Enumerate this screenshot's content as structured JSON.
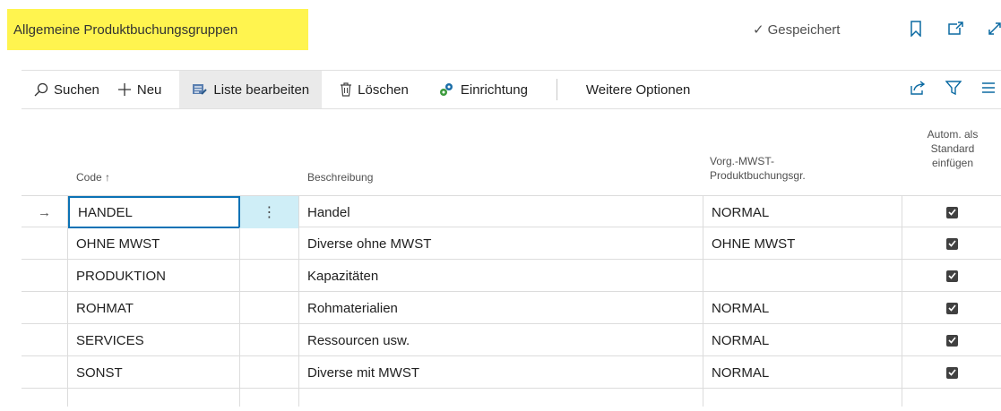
{
  "page": {
    "title": "Allgemeine Produktbuchungsgruppen",
    "saved_label": "Gespeichert"
  },
  "toolbar": {
    "search_label": "Suchen",
    "new_label": "Neu",
    "edit_list_label": "Liste bearbeiten",
    "delete_label": "Löschen",
    "setup_label": "Einrichtung",
    "more_options_label": "Weitere Optionen"
  },
  "table": {
    "headers": {
      "code": "Code ↑",
      "description": "Beschreibung",
      "vat_line1": "Vorg.-MWST-",
      "vat_line2": "Produktbuchungsgr.",
      "auto_line1": "Autom. als",
      "auto_line2": "Standard",
      "auto_line3": "einfügen"
    },
    "rows": [
      {
        "code": "HANDEL",
        "description": "Handel",
        "vat": "NORMAL",
        "auto": true
      },
      {
        "code": "OHNE MWST",
        "description": "Diverse ohne MWST",
        "vat": "OHNE MWST",
        "auto": true
      },
      {
        "code": "PRODUKTION",
        "description": "Kapazitäten",
        "vat": "",
        "auto": true
      },
      {
        "code": "ROHMAT",
        "description": "Rohmaterialien",
        "vat": "NORMAL",
        "auto": true
      },
      {
        "code": "SERVICES",
        "description": "Ressourcen usw.",
        "vat": "NORMAL",
        "auto": true
      },
      {
        "code": "SONST",
        "description": "Diverse mit MWST",
        "vat": "NORMAL",
        "auto": true
      }
    ]
  },
  "colors": {
    "title_highlight": "#fff44f",
    "active_border": "#0b72b5",
    "active_dots_bg": "#cfeef7"
  }
}
